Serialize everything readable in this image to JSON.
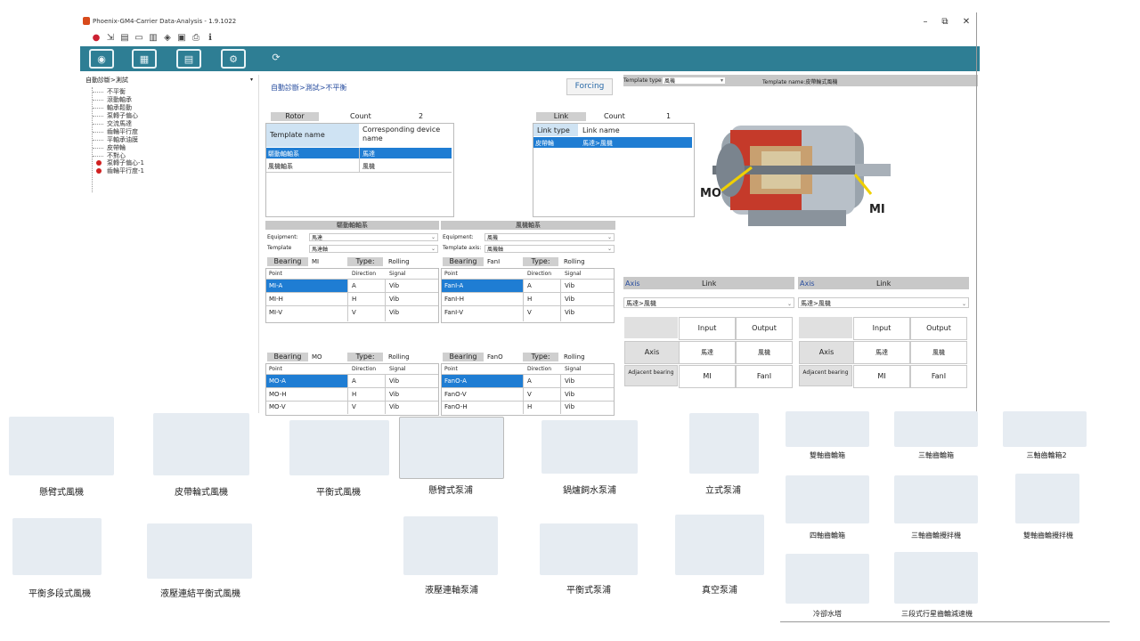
{
  "window": {
    "title": "Phoenix-GM4-Carrier Data-Analysis - 1.9.1022",
    "minimize": "–",
    "restore": "⧉",
    "close": "✕"
  },
  "tree": {
    "selector": "自動診斷>測試",
    "items": [
      "不平衡",
      "滾動軸承",
      "軸承鬆動",
      "泵轉子偏心",
      "交流馬達",
      "齒輪平行度",
      "平軸承油膜",
      "皮帶輪",
      "不對心"
    ],
    "flagged": [
      "泵轉子偏心-1",
      "齒輪平行度-1"
    ]
  },
  "center": {
    "breadcrumb": "自動診斷>測試>不平衡",
    "forcing": "Forcing",
    "rotor": {
      "label": "Rotor",
      "count_label": "Count",
      "count": "2",
      "headers": [
        "Template name",
        "Corresponding device name"
      ],
      "rows": [
        [
          "驅動軸軸系",
          "馬達"
        ],
        [
          "風機軸系",
          "風機"
        ]
      ]
    },
    "link": {
      "label": "Link",
      "count_label": "Count",
      "count": "1",
      "headers": [
        "Link type",
        "Link name"
      ],
      "rows": [
        [
          "皮帶輪",
          "馬達>風機"
        ]
      ]
    },
    "left_panel": {
      "title": "驅動軸軸系",
      "equipment_label": "Equipment:",
      "equipment": "馬達",
      "template_label": "Template",
      "template": "馬達軸",
      "bearing1": {
        "label": "Bearing",
        "name": "MI",
        "type_label": "Type:",
        "type": "Rolling",
        "headers": [
          "Point",
          "Direction",
          "Signal"
        ],
        "rows": [
          [
            "MI-A",
            "A",
            "Vib"
          ],
          [
            "MI-H",
            "H",
            "Vib"
          ],
          [
            "MI-V",
            "V",
            "Vib"
          ]
        ]
      },
      "bearing2": {
        "label": "Bearing",
        "name": "MO",
        "type_label": "Type:",
        "type": "Rolling",
        "headers": [
          "Point",
          "Direction",
          "Signal"
        ],
        "rows": [
          [
            "MO-A",
            "A",
            "Vib"
          ],
          [
            "MO-H",
            "H",
            "Vib"
          ],
          [
            "MO-V",
            "V",
            "Vib"
          ]
        ]
      }
    },
    "right_panel": {
      "title": "風機軸系",
      "equipment_label": "Equipment:",
      "equipment": "風機",
      "template_label": "Template axis:",
      "template": "風機軸",
      "bearing1": {
        "label": "Bearing",
        "name": "FanI",
        "type_label": "Type:",
        "type": "Rolling",
        "headers": [
          "Point",
          "Direction",
          "Signal"
        ],
        "rows": [
          [
            "FanI-A",
            "A",
            "Vib"
          ],
          [
            "FanI-H",
            "H",
            "Vib"
          ],
          [
            "FanI-V",
            "V",
            "Vib"
          ]
        ]
      },
      "bearing2": {
        "label": "Bearing",
        "name": "FanO",
        "type_label": "Type:",
        "type": "Rolling",
        "headers": [
          "Point",
          "Direction",
          "Signal"
        ],
        "rows": [
          [
            "FanO-A",
            "A",
            "Vib"
          ],
          [
            "FanO-V",
            "V",
            "Vib"
          ],
          [
            "FanO-H",
            "H",
            "Vib"
          ]
        ]
      }
    }
  },
  "right": {
    "template_type_label": "Template type",
    "template_type": "風機",
    "template_name": "Template name:皮帶輪式風機",
    "image_labels": {
      "left": "MO",
      "right": "MI"
    },
    "axis_panels": [
      {
        "axis_label": "Axis",
        "link_label": "Link",
        "combo": "馬達>風機",
        "input": "Input",
        "output": "Output",
        "row1_label": "Axis",
        "row1": [
          "馬達",
          "風機"
        ],
        "row2_label": "Adjacent bearing",
        "row2": [
          "MI",
          "FanI"
        ]
      },
      {
        "axis_label": "Axis",
        "link_label": "Link",
        "combo": "馬達>風機",
        "input": "Input",
        "output": "Output",
        "row1_label": "Axis",
        "row1": [
          "馬達",
          "風機"
        ],
        "row2_label": "Adjacent bearing",
        "row2": [
          "MI",
          "FanI"
        ]
      }
    ]
  },
  "catalog": {
    "items": [
      "懸臂式風機",
      "皮帶輪式風機",
      "平衡式風機",
      "懸臂式泵浦",
      "鍋爐飼水泵浦",
      "立式泵浦",
      "平衡多段式風機",
      "液壓連結平衡式風機",
      "液壓連軸泵浦",
      "平衡式泵浦",
      "真空泵浦"
    ],
    "gearbox_items": [
      "雙軸齒輪箱",
      "三軸齒輪箱",
      "三軸齒輪箱2",
      "四軸齒輪箱",
      "三軸齒輪攪拌機",
      "雙軸齒輪攪拌機",
      "冷卻水塔",
      "三段式行星齒輪減速機"
    ]
  },
  "colors": {
    "toolbar": "#2e7e94",
    "selection": "#1f7dd3",
    "header": "#cfe3f3",
    "gray": "#cfcfcf"
  }
}
